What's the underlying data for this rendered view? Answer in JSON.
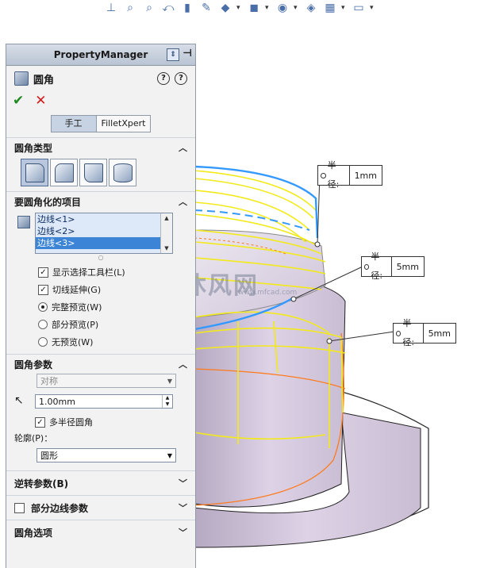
{
  "panel": {
    "title": "PropertyManager",
    "feature_name": "圆角",
    "mode_tabs": [
      "手工",
      "FilletXpert"
    ],
    "sections": {
      "fillet_type": {
        "title": "圆角类型"
      },
      "items_to_fillet": {
        "title": "要圆角化的项目",
        "edges": [
          "边线<1>",
          "边线<2>",
          "边线<3>"
        ],
        "options": [
          {
            "label": "显示选择工具栏(L)",
            "checked": true
          },
          {
            "label": "切线延伸(G)",
            "checked": true
          }
        ],
        "preview_options": [
          {
            "label": "完整预览(W)",
            "selected": true
          },
          {
            "label": "部分预览(P)",
            "selected": false
          },
          {
            "label": "无预览(W)",
            "selected": false
          }
        ]
      },
      "fillet_params": {
        "title": "圆角参数",
        "method": "对称",
        "radius": "1.00mm",
        "multi_radius_label": "多半径圆角",
        "profile_label": "轮廓(P)：",
        "profile_value": "圆形"
      },
      "setback_params": {
        "title": "逆转参数(B)"
      },
      "partial_edge": {
        "title": "部分边线参数"
      },
      "fillet_options": {
        "title": "圆角选项"
      }
    }
  },
  "callouts": [
    {
      "label": "半径:",
      "value": "1mm"
    },
    {
      "label": "半径:",
      "value": "5mm"
    },
    {
      "label": "半径:",
      "value": "5mm"
    }
  ],
  "watermark": {
    "text": "沐风网",
    "sub": "www.mfcad.com"
  },
  "toolbar_icons": [
    "view-orientation-icon",
    "zoom-to-fit-icon",
    "zoom-area-icon",
    "previous-view-icon",
    "section-view-icon",
    "dynamic-annotation-icon",
    "view-orientation-cube-icon",
    "display-style-icon",
    "hide-show-icon",
    "edit-appearance-icon",
    "apply-scene-icon",
    "view-settings-icon"
  ],
  "colors": {
    "edge_highlight": "#3399ff",
    "preview": "#f2ea1a",
    "body": "#d3c7dd",
    "arrow": "#e02424"
  }
}
